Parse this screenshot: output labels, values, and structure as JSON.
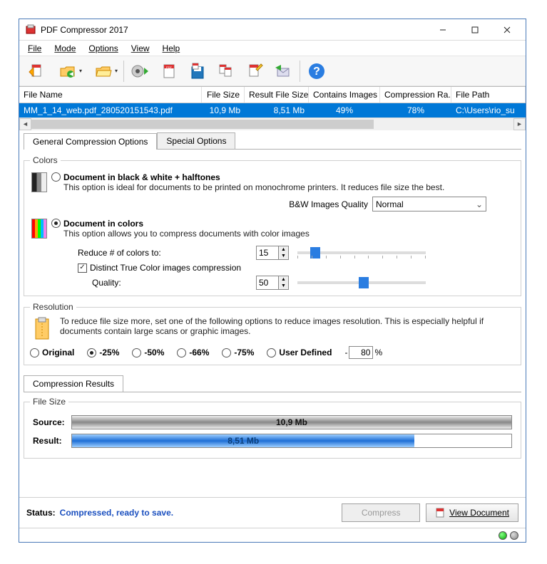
{
  "window": {
    "title": "PDF Compressor 2017"
  },
  "menu": {
    "file": "File",
    "mode": "Mode",
    "options": "Options",
    "view": "View",
    "help": "Help"
  },
  "grid": {
    "headers": {
      "name": "File Name",
      "size": "File Size",
      "result": "Result File Size",
      "images": "Contains Images",
      "ratio": "Compression Ra...",
      "path": "File Path"
    },
    "row": {
      "name": "MM_1_14_web.pdf_280520151543.pdf",
      "size": "10,9 Mb",
      "result": "8,51 Mb",
      "images": "49%",
      "ratio": "78%",
      "path": "C:\\Users\\rio_su"
    }
  },
  "tabs": {
    "general": "General Compression Options",
    "special": "Special Options"
  },
  "colors": {
    "legend": "Colors",
    "bw_title": "Document in black & white + halftones",
    "bw_desc": "This option is ideal for documents to be printed on monochrome printers. It reduces file size the best.",
    "bw_quality_label": "B&W Images Quality",
    "bw_quality_value": "Normal",
    "color_title": "Document in colors",
    "color_desc": "This option allows you to compress documents with color images",
    "reduce_label": "Reduce # of colors to:",
    "reduce_value": "15",
    "distinct_label": "Distinct True Color images compression",
    "quality_label": "Quality:",
    "quality_value": "50"
  },
  "resolution": {
    "legend": "Resolution",
    "desc": "To reduce file size more, set one of the following options to reduce images resolution. This is especially helpful if documents contain large scans or graphic images.",
    "opt_original": "Original",
    "opt_25": "-25%",
    "opt_50": "-50%",
    "opt_66": "-66%",
    "opt_75": "-75%",
    "opt_user": "User Defined",
    "user_value": "80",
    "user_suffix": "%",
    "user_prefix": "-"
  },
  "results": {
    "tab": "Compression Results",
    "legend": "File Size",
    "source_label": "Source:",
    "source_value": "10,9 Mb",
    "result_label": "Result:",
    "result_value": "8,51 Mb"
  },
  "footer": {
    "status_label": "Status:",
    "status_text": "Compressed, ready to save.",
    "compress_btn": "Compress",
    "view_btn": "View Document"
  }
}
